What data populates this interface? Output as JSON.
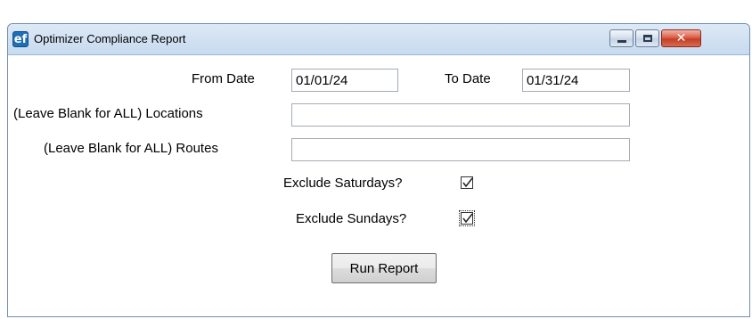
{
  "window": {
    "icon_text": "ef",
    "title": "Optimizer Compliance Report"
  },
  "form": {
    "from_date_label": "From Date",
    "from_date_value": "01/01/24",
    "to_date_label": "To Date",
    "to_date_value": "01/31/24",
    "locations_label": "(Leave Blank for ALL) Locations",
    "locations_value": "",
    "routes_label": "(Leave Blank for ALL) Routes",
    "routes_value": "",
    "exclude_saturdays_label": "Exclude Saturdays?",
    "exclude_saturdays_checked": true,
    "exclude_sundays_label": "Exclude Sundays?",
    "exclude_sundays_checked": true,
    "run_button_label": "Run Report"
  }
}
